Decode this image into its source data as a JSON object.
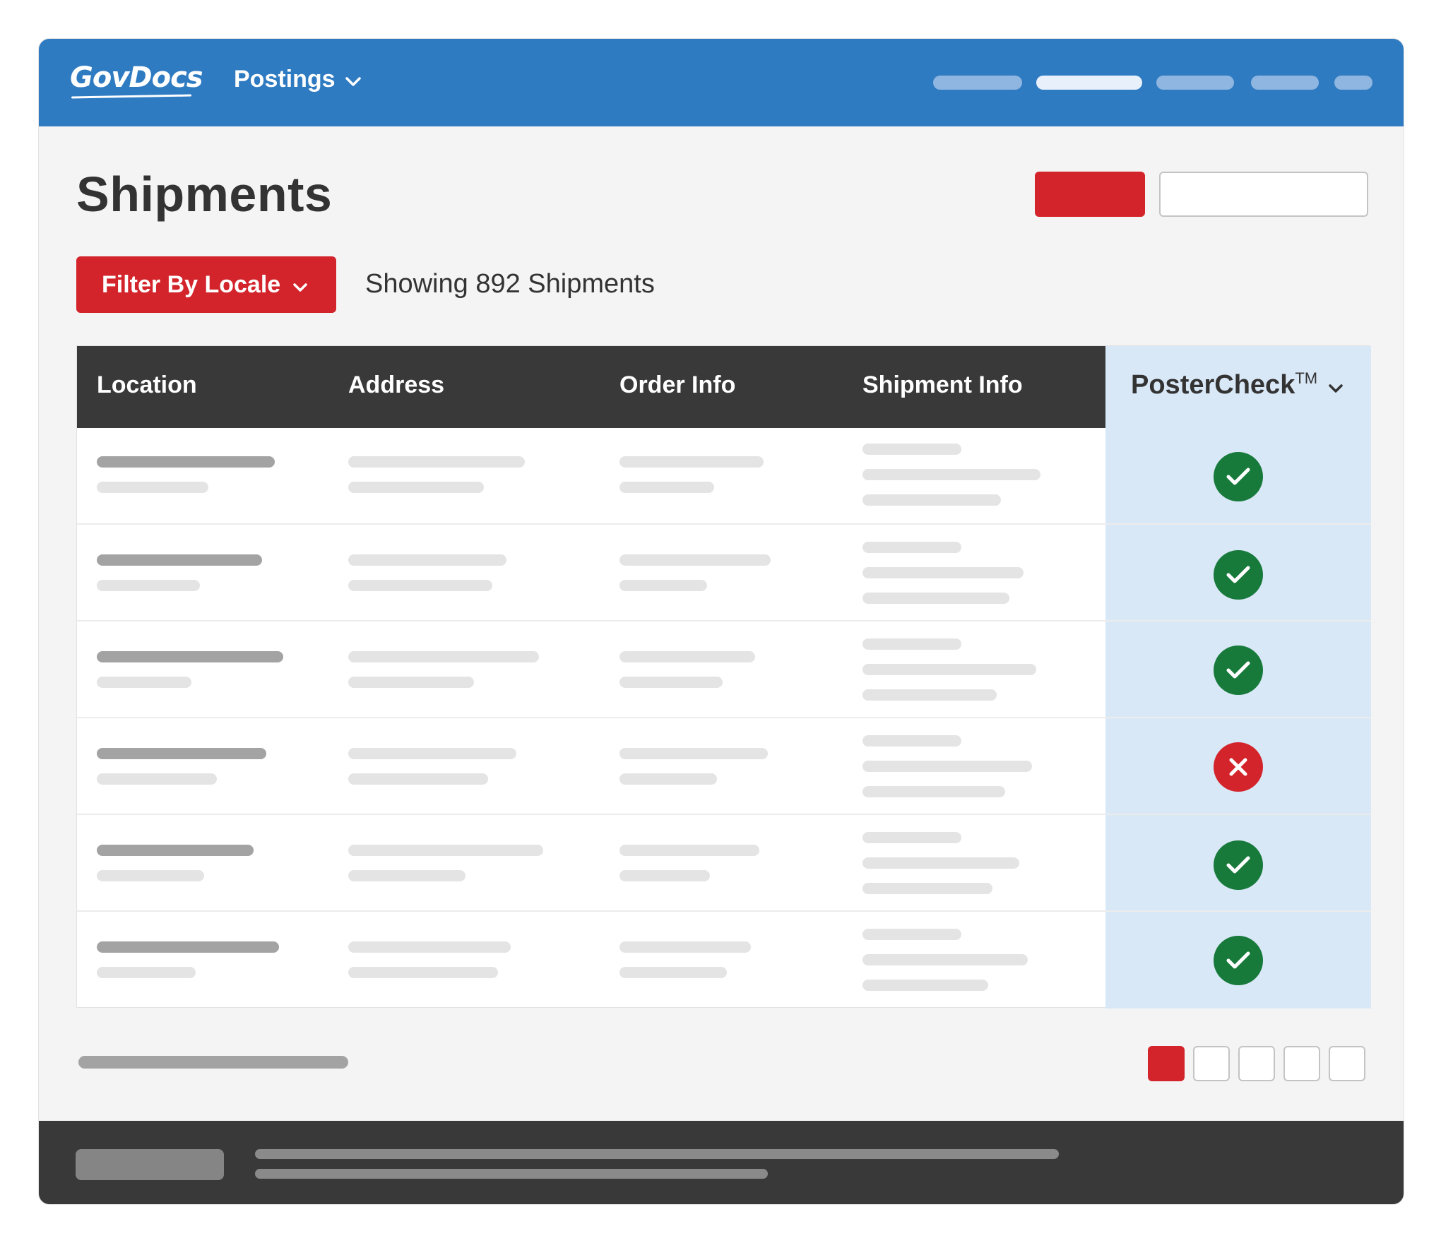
{
  "app": {
    "logo_text": "GovDocs",
    "nav_menu_label": "Postings"
  },
  "page": {
    "title": "Shipments",
    "filter_label": "Filter By Locale",
    "showing_text": "Showing 892 Shipments"
  },
  "table": {
    "columns": [
      "Location",
      "Address",
      "Order Info",
      "Shipment Info"
    ],
    "postercheck_label": "PosterCheck",
    "postercheck_mark": "TM",
    "rows": [
      {
        "status": "pass",
        "status_icon": "check-icon"
      },
      {
        "status": "pass",
        "status_icon": "check-icon"
      },
      {
        "status": "pass",
        "status_icon": "check-icon"
      },
      {
        "status": "fail",
        "status_icon": "x-icon"
      },
      {
        "status": "pass",
        "status_icon": "check-icon"
      },
      {
        "status": "pass",
        "status_icon": "check-icon"
      }
    ]
  },
  "pagination": {
    "pages": 5,
    "current_page": 1
  },
  "colors": {
    "brand_blue": "#2f7bc2",
    "accent_red": "#d3242b",
    "pass_green": "#177a3a",
    "header_dark": "#393939",
    "postercheck_bg": "#d9e8f7"
  }
}
